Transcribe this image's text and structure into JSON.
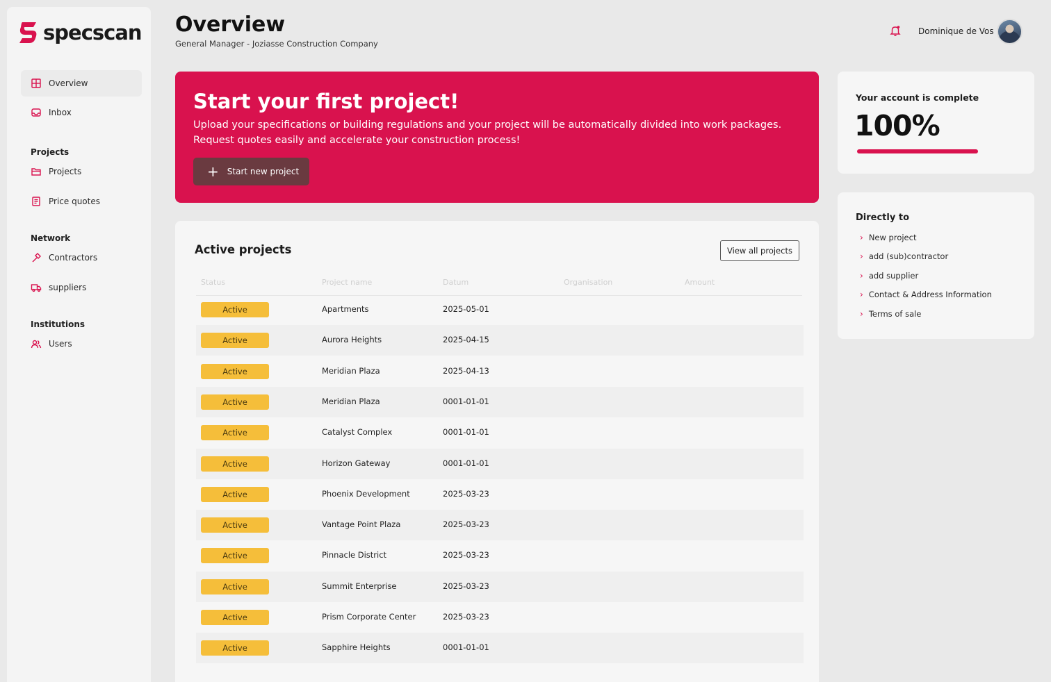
{
  "brand": {
    "name": "specscan",
    "accent": "#d9124e"
  },
  "sidebar": {
    "items_top": [
      {
        "label": "Overview",
        "icon": "grid-icon"
      },
      {
        "label": "Inbox",
        "icon": "inbox-icon"
      }
    ],
    "sections": [
      {
        "heading": "Projects",
        "items": [
          {
            "label": "Projects",
            "icon": "folder-icon"
          },
          {
            "label": "Price quotes",
            "icon": "document-icon"
          }
        ]
      },
      {
        "heading": "Network",
        "items": [
          {
            "label": "Contractors",
            "icon": "hammer-icon"
          },
          {
            "label": "suppliers",
            "icon": "truck-icon"
          }
        ]
      },
      {
        "heading": "Institutions",
        "items": [
          {
            "label": "Users",
            "icon": "users-icon"
          }
        ]
      }
    ]
  },
  "header": {
    "title": "Overview",
    "subtitle": "General Manager - Joziasse Construction Company",
    "user_name": "Dominique de Vos"
  },
  "hero": {
    "title": "Start your first project!",
    "text": "Upload your specifications or building regulations and your project will be automatically divided into work packages. Request quotes easily and accelerate your construction process!",
    "button_label": "Start new project"
  },
  "account": {
    "label": "Your account is complete",
    "percent_text": "100%",
    "progress": 1.0
  },
  "links": {
    "title": "Directly to",
    "items": [
      "New project",
      "add (sub)contractor",
      "add supplier",
      "Contact & Address Information",
      "Terms of sale"
    ]
  },
  "projects": {
    "title": "Active projects",
    "view_all_label": "View all projects",
    "columns": [
      "Status",
      "Project name",
      "Datum",
      "Organisation",
      "Amount"
    ],
    "rows": [
      {
        "status": "Active",
        "name": "Apartments",
        "date": "2025-05-01"
      },
      {
        "status": "Active",
        "name": "Aurora Heights",
        "date": "2025-04-15"
      },
      {
        "status": "Active",
        "name": "Meridian Plaza",
        "date": "2025-04-13"
      },
      {
        "status": "Active",
        "name": "Meridian Plaza",
        "date": "0001-01-01"
      },
      {
        "status": "Active",
        "name": "Catalyst Complex",
        "date": "0001-01-01"
      },
      {
        "status": "Active",
        "name": "Horizon Gateway",
        "date": "0001-01-01"
      },
      {
        "status": "Active",
        "name": "Phoenix Development",
        "date": "2025-03-23"
      },
      {
        "status": "Active",
        "name": "Vantage Point Plaza",
        "date": "2025-03-23"
      },
      {
        "status": "Active",
        "name": "Pinnacle District",
        "date": "2025-03-23"
      },
      {
        "status": "Active",
        "name": "Summit Enterprise",
        "date": "2025-03-23"
      },
      {
        "status": "Active",
        "name": "Prism Corporate Center",
        "date": "2025-03-23"
      },
      {
        "status": "Active",
        "name": "Sapphire Heights",
        "date": "0001-01-01"
      }
    ]
  }
}
